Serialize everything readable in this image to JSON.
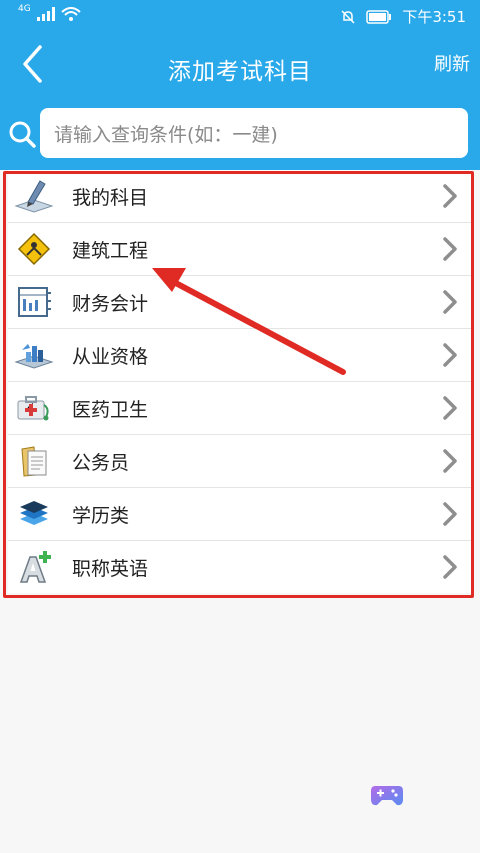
{
  "status_bar": {
    "network": "4G",
    "time": "下午3:51"
  },
  "header": {
    "title": "添加考试科目",
    "refresh_label": "刷新"
  },
  "search": {
    "placeholder": "请输入查询条件(如：一建)"
  },
  "categories": [
    {
      "label": "我的科目",
      "icon": "pen-book-icon"
    },
    {
      "label": "建筑工程",
      "icon": "construction-sign-icon"
    },
    {
      "label": "财务会计",
      "icon": "ledger-icon"
    },
    {
      "label": "从业资格",
      "icon": "certificate-stack-icon"
    },
    {
      "label": "医药卫生",
      "icon": "medical-kit-icon"
    },
    {
      "label": "公务员",
      "icon": "document-folder-icon"
    },
    {
      "label": "学历类",
      "icon": "graduation-layers-icon"
    },
    {
      "label": "职称英语",
      "icon": "letter-a-plus-icon"
    }
  ],
  "colors": {
    "header_blue": "#29a9ea",
    "annotation_red": "#e02a24"
  }
}
